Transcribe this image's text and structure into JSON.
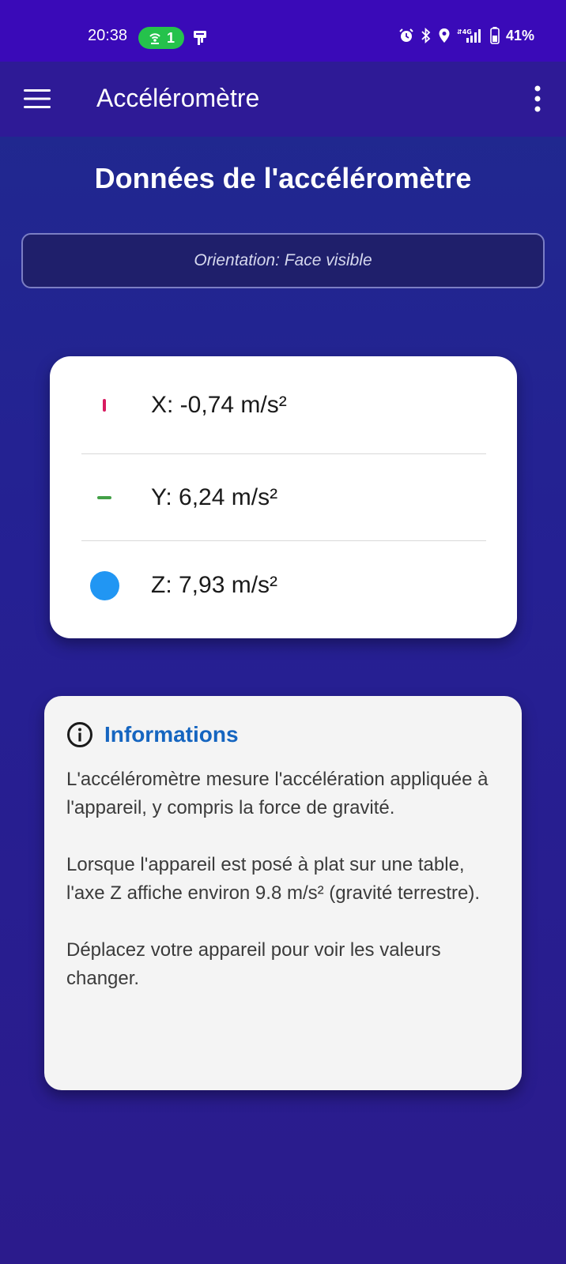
{
  "status_bar": {
    "time": "20:38",
    "hotspot_count": "1",
    "battery": "41%",
    "network": "4G"
  },
  "app_bar": {
    "title": "Accéléromètre"
  },
  "page": {
    "title": "Données de l'accéléromètre",
    "orientation": "Orientation: Face visible"
  },
  "axes": {
    "x": {
      "label": "X: -0,74 m/s²",
      "color": "#d81b60"
    },
    "y": {
      "label": "Y: 6,24 m/s²",
      "color": "#43a047"
    },
    "z": {
      "label": "Z: 7,93 m/s²",
      "color": "#2196f3"
    }
  },
  "info": {
    "title": "Informations",
    "paragraphs": [
      "L'accéléromètre mesure l'accélération appliquée à l'appareil, y compris la force de gravité.",
      "Lorsque l'appareil est posé à plat sur une table, l'axe Z affiche environ 9.8 m/s² (gravité terrestre).",
      "Déplacez votre appareil pour voir les valeurs changer."
    ]
  },
  "colors": {
    "status_bar": "#3a0ab8",
    "app_bar": "#2e1a96",
    "accent": "#1565c0",
    "hotspot": "#25c24c"
  }
}
